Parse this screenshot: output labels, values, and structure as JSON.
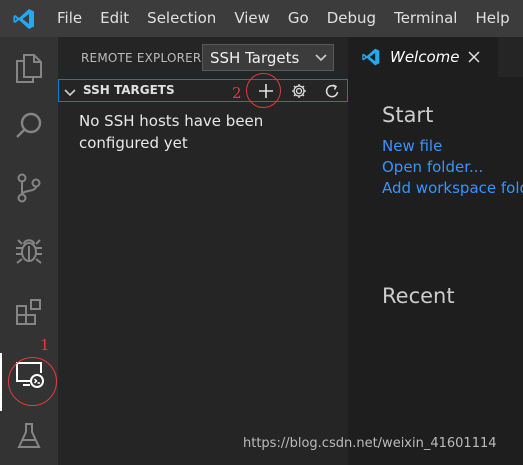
{
  "menu": {
    "items": [
      "File",
      "Edit",
      "Selection",
      "View",
      "Go",
      "Debug",
      "Terminal",
      "Help"
    ]
  },
  "activity_bar": {
    "items": [
      "explorer-icon",
      "search-icon",
      "source-control-icon",
      "debug-icon",
      "extensions-icon",
      "remote-explorer-icon",
      "test-icon"
    ],
    "active": "remote-explorer-icon"
  },
  "sidebar": {
    "title": "REMOTE EXPLORER",
    "select_value": "SSH Targets",
    "section_title": "SSH TARGETS",
    "section_actions": [
      "add-icon",
      "gear-icon",
      "refresh-icon"
    ],
    "empty_message": "No SSH hosts have been configured yet"
  },
  "annotations": {
    "label_1": "1",
    "label_2": "2"
  },
  "editor": {
    "tab_label": "Welcome",
    "start_heading": "Start",
    "links": [
      "New file",
      "Open folder...",
      "Add workspace folder"
    ],
    "recent_heading": "Recent"
  },
  "watermark": "https://blog.csdn.net/weixin_41601114",
  "colors": {
    "accent": "#007acc",
    "focus_border": "#007fd4",
    "link": "#3794ff",
    "annotation": "#e03c3c"
  }
}
